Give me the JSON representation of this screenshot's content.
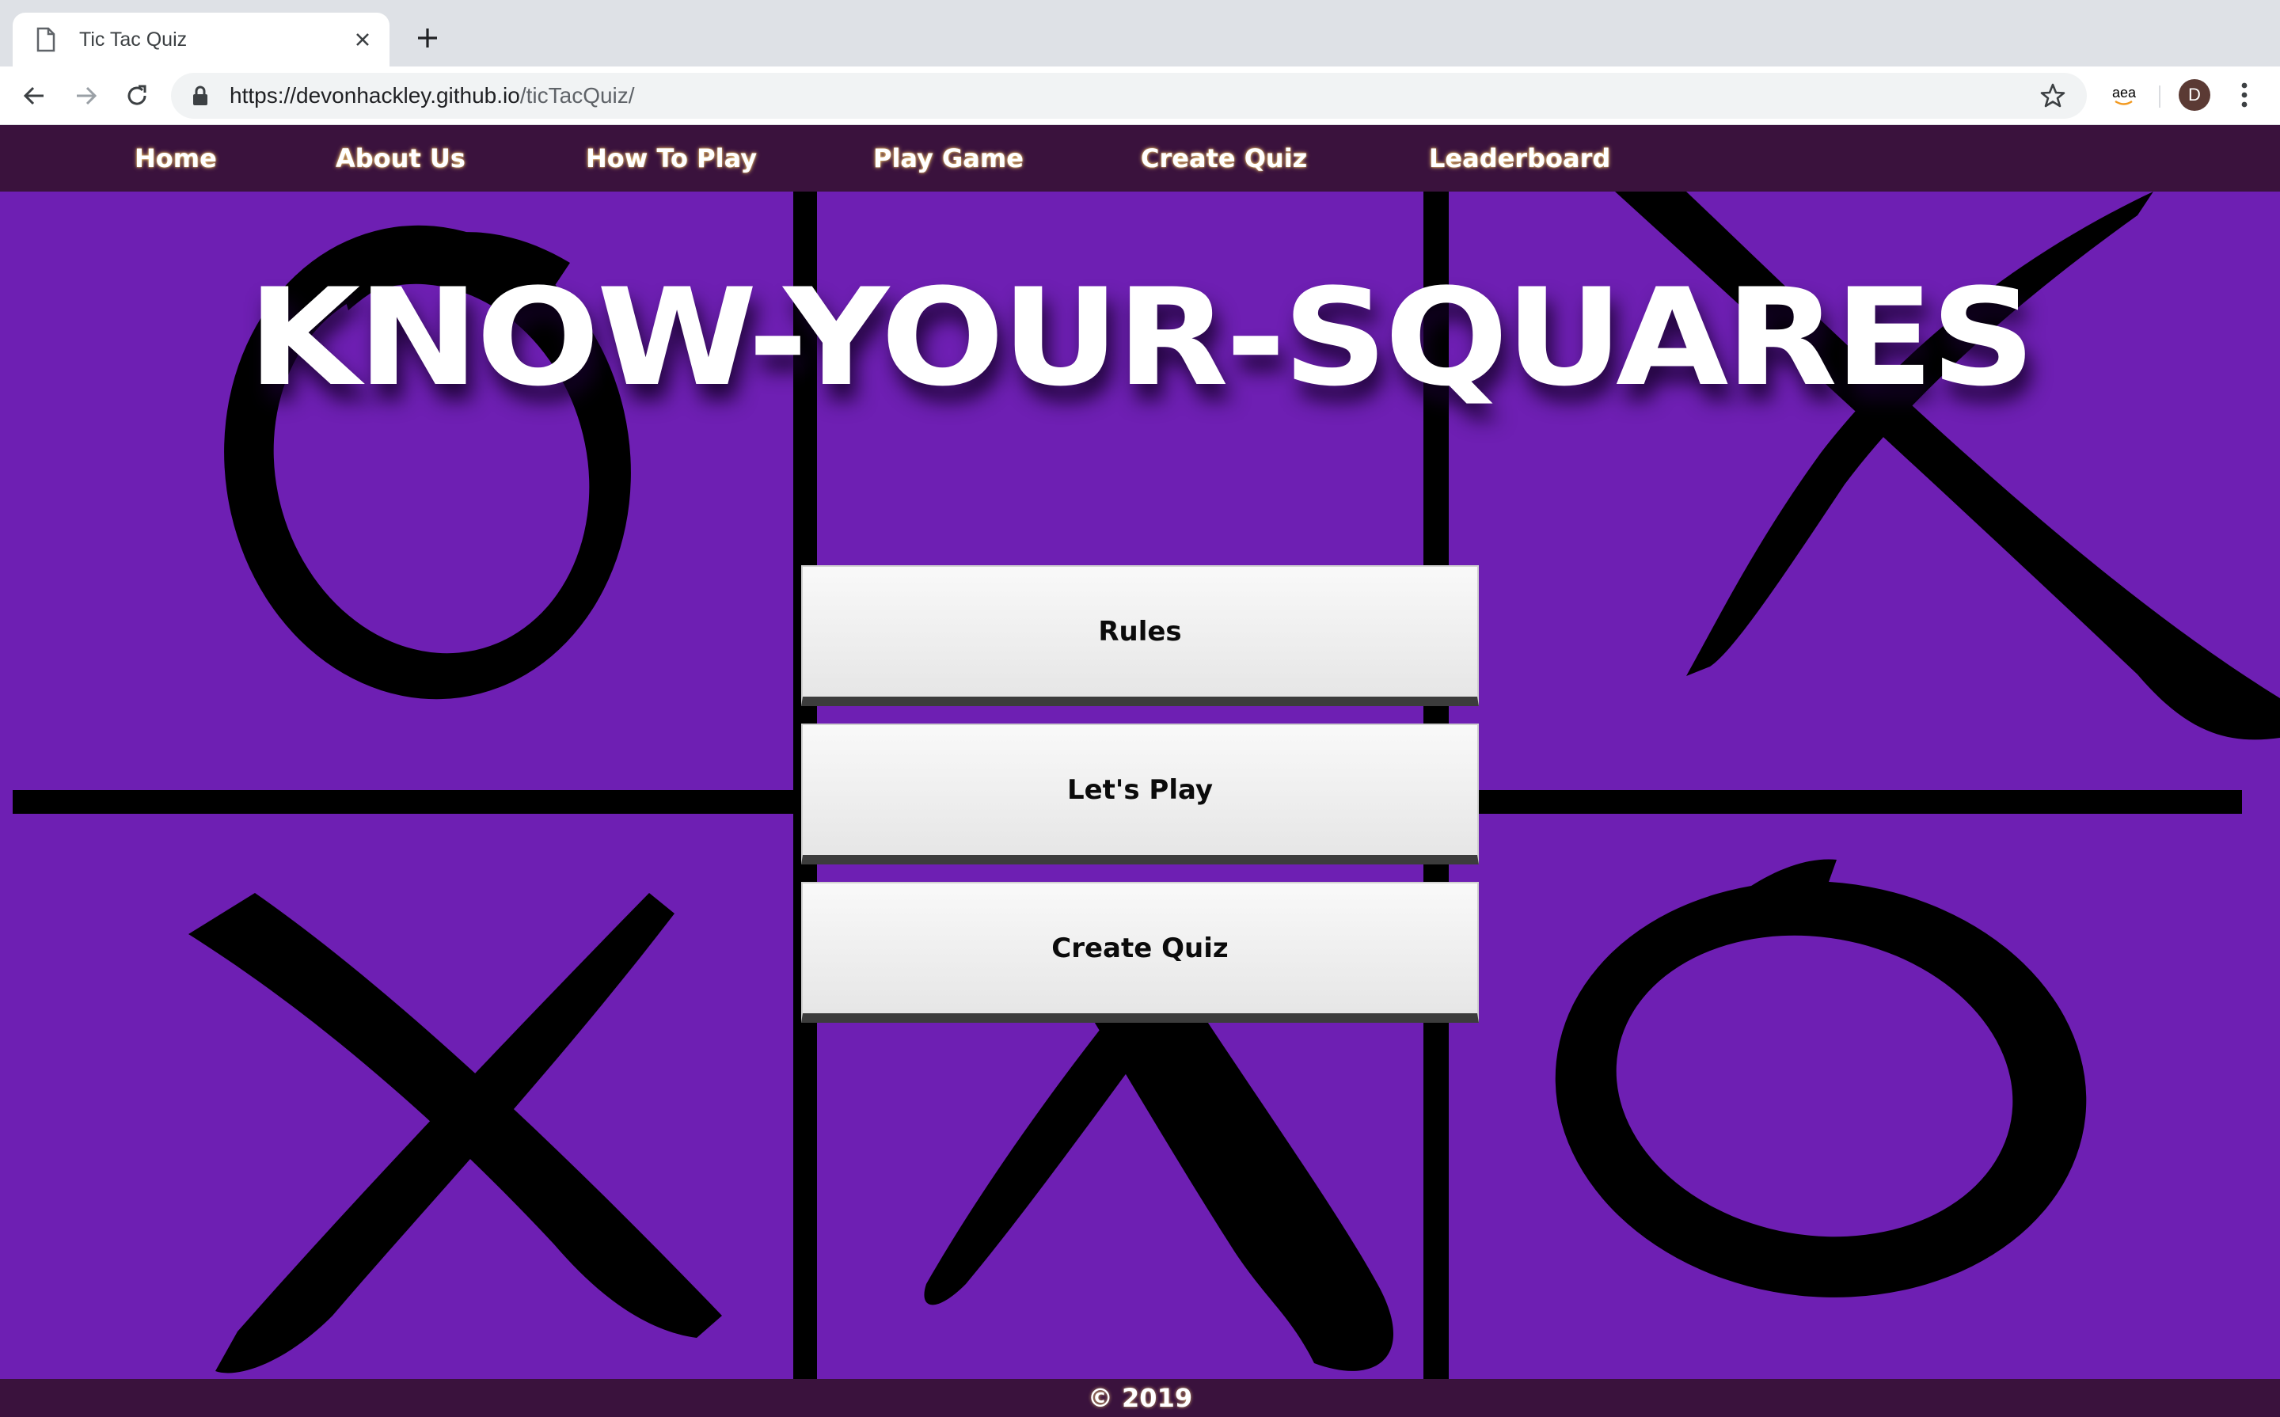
{
  "browser": {
    "tab_title": "Tic Tac Quiz",
    "url_host": "https://devonhackley.github.io",
    "url_path": "/ticTacQuiz/",
    "extension_text": "aea",
    "avatar_letter": "D"
  },
  "nav": {
    "items": [
      {
        "label": "Home"
      },
      {
        "label": "About Us"
      },
      {
        "label": "How To Play"
      },
      {
        "label": "Play Game"
      },
      {
        "label": "Create Quiz"
      },
      {
        "label": "Leaderboard"
      }
    ]
  },
  "hero": {
    "title": "KNOW-YOUR-SQUARES"
  },
  "buttons": {
    "rules": "Rules",
    "play": "Let's Play",
    "create": "Create Quiz"
  },
  "footer": {
    "copyright": "© 2019"
  },
  "colors": {
    "board_background": "#6e1fb3",
    "nav_background": "#3a123d",
    "marks": "#000000"
  }
}
